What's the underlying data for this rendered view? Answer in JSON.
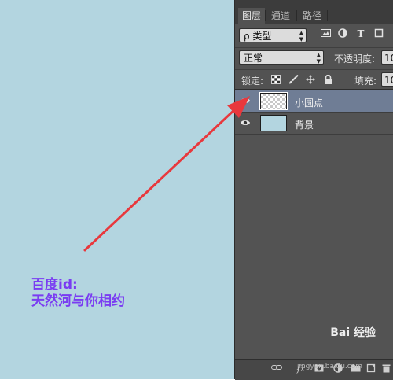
{
  "canvas": {
    "background_color": "#b3d5e0",
    "annotation_color": "#7a3cf2",
    "arrow_color": "#e8383d",
    "annotation_lines": [
      "百度id:",
      "天然河与你相约"
    ]
  },
  "panel": {
    "tabs": [
      {
        "label": "图层",
        "active": true
      },
      {
        "label": "通道",
        "active": false
      },
      {
        "label": "路径",
        "active": false
      }
    ],
    "filter": {
      "kind_label": "ρ 类型",
      "icons": [
        "image-filter-icon",
        "adjustment-filter-icon",
        "type-filter-icon",
        "shape-filter-icon"
      ]
    },
    "blend": {
      "mode": "正常",
      "opacity_label": "不透明度:",
      "opacity_value": "10"
    },
    "lock": {
      "label": "锁定:",
      "fill_label": "填充:",
      "fill_value": "10"
    },
    "layers": [
      {
        "name": "小圆点",
        "selected": true,
        "thumb": "transparent"
      },
      {
        "name": "背景",
        "selected": false,
        "thumb": "solid"
      }
    ],
    "bottom": {
      "fx_label": "fx"
    }
  },
  "watermark": {
    "brand": "Bai 经验",
    "sub": "jingyan.baidu.com"
  }
}
